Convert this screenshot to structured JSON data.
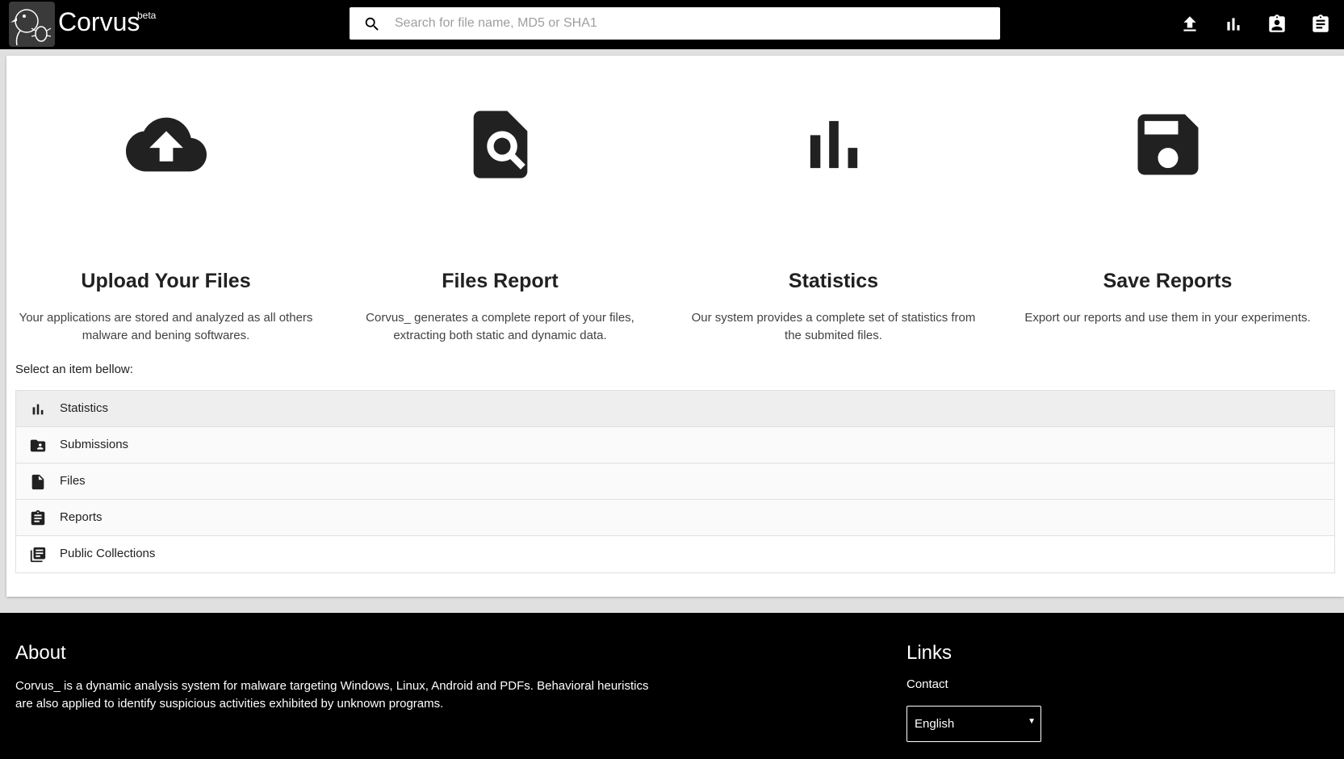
{
  "header": {
    "brand": "Corvus",
    "beta": "beta",
    "search_placeholder": "Search for file name, MD5 or SHA1",
    "nav_icons": [
      "upload-icon",
      "bar-chart-icon",
      "assignment-ind-icon",
      "clipboard-icon"
    ]
  },
  "features": [
    {
      "icon": "cloud-upload-icon",
      "title": "Upload Your Files",
      "text": "Your applications are stored and analyzed as all others malware and bening softwares."
    },
    {
      "icon": "file-search-icon",
      "title": "Files Report",
      "text": "Corvus_ generates a complete report of your files, extracting both static and dynamic data."
    },
    {
      "icon": "bar-chart-icon",
      "title": "Statistics",
      "text": "Our system provides a complete set of statistics from the submited files."
    },
    {
      "icon": "save-icon",
      "title": "Save Reports",
      "text": "Export our reports and use them in your experiments."
    }
  ],
  "select_label": "Select an item bellow:",
  "menu": [
    {
      "icon": "bar-chart-icon",
      "label": "Statistics"
    },
    {
      "icon": "folder-shared-icon",
      "label": "Submissions"
    },
    {
      "icon": "file-icon",
      "label": "Files"
    },
    {
      "icon": "clipboard-icon",
      "label": "Reports"
    },
    {
      "icon": "library-books-icon",
      "label": "Public Collections"
    }
  ],
  "footer": {
    "about_title": "About",
    "about_text": "Corvus_ is a dynamic analysis system for malware targeting Windows, Linux, Android and PDFs. Behavioral heuristics are also applied to identify suspicious activities exhibited by unknown programs.",
    "links_title": "Links",
    "contact": "Contact",
    "language": "English"
  },
  "colors": {
    "header_bg": "#000000",
    "icon_dark": "#212121",
    "active_row": "#eeeeee"
  }
}
